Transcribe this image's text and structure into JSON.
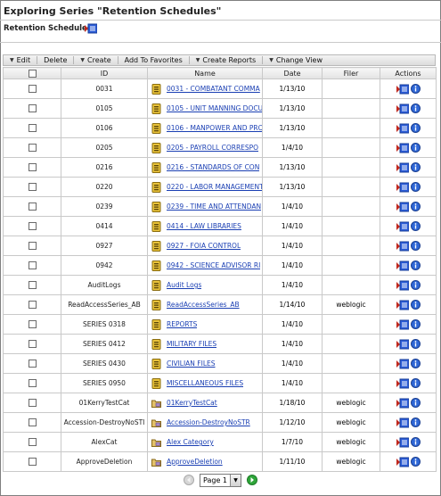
{
  "header": {
    "title": "Exploring Series \"Retention Schedules\"",
    "subtitle": "Retention Schedules"
  },
  "toolbar": {
    "edit": "Edit",
    "delete": "Delete",
    "create": "Create",
    "add_to_favorites": "Add To Favorites",
    "create_reports": "Create Reports",
    "change_view": "Change View"
  },
  "columns": {
    "id": "ID",
    "name": "Name",
    "date": "Date",
    "filer": "Filer",
    "actions": "Actions"
  },
  "rows": [
    {
      "id": "0031",
      "name": "0031 - COMBATANT COMMA",
      "date": "1/13/10",
      "filer": "",
      "icon": "schedule-icon"
    },
    {
      "id": "0105",
      "name": "0105 - UNIT MANNING DOCU",
      "date": "1/13/10",
      "filer": "",
      "icon": "schedule-icon"
    },
    {
      "id": "0106",
      "name": "0106 - MANPOWER AND PRO",
      "date": "1/13/10",
      "filer": "",
      "icon": "schedule-icon"
    },
    {
      "id": "0205",
      "name": "0205 - PAYROLL CORRESPO",
      "date": "1/4/10",
      "filer": "",
      "icon": "schedule-icon"
    },
    {
      "id": "0216",
      "name": "0216 - STANDARDS OF CON",
      "date": "1/13/10",
      "filer": "",
      "icon": "schedule-icon"
    },
    {
      "id": "0220",
      "name": "0220 - LABOR MANAGEMENT",
      "date": "1/13/10",
      "filer": "",
      "icon": "schedule-icon"
    },
    {
      "id": "0239",
      "name": "0239 - TIME AND ATTENDAN",
      "date": "1/4/10",
      "filer": "",
      "icon": "schedule-icon"
    },
    {
      "id": "0414",
      "name": "0414 - LAW LIBRARIES",
      "date": "1/4/10",
      "filer": "",
      "icon": "schedule-icon"
    },
    {
      "id": "0927",
      "name": "0927 - FOIA CONTROL",
      "date": "1/4/10",
      "filer": "",
      "icon": "schedule-icon"
    },
    {
      "id": "0942",
      "name": "0942 - SCIENCE ADVISOR RI",
      "date": "1/4/10",
      "filer": "",
      "icon": "schedule-icon"
    },
    {
      "id": "AuditLogs",
      "name": "Audit Logs",
      "date": "1/4/10",
      "filer": "",
      "icon": "schedule-icon"
    },
    {
      "id": "ReadAccessSeries_AB",
      "name": "ReadAccessSeries_AB",
      "date": "1/14/10",
      "filer": "weblogic",
      "icon": "schedule-icon"
    },
    {
      "id": "SERIES 0318",
      "name": "REPORTS",
      "date": "1/4/10",
      "filer": "",
      "icon": "schedule-icon"
    },
    {
      "id": "SERIES 0412",
      "name": "MILITARY FILES",
      "date": "1/4/10",
      "filer": "",
      "icon": "schedule-icon"
    },
    {
      "id": "SERIES 0430",
      "name": "CIVILIAN FILES",
      "date": "1/4/10",
      "filer": "",
      "icon": "schedule-icon"
    },
    {
      "id": "SERIES 0950",
      "name": "MISCELLANEOUS FILES",
      "date": "1/4/10",
      "filer": "",
      "icon": "schedule-icon"
    },
    {
      "id": "01KerryTestCat",
      "name": "01KerryTestCat",
      "date": "1/18/10",
      "filer": "weblogic",
      "icon": "category-folder-icon"
    },
    {
      "id": "Accession-DestroyNoSTI",
      "name": "Accession-DestroyNoSTR",
      "date": "1/12/10",
      "filer": "weblogic",
      "icon": "category-folder-icon"
    },
    {
      "id": "AlexCat",
      "name": "Alex Category",
      "date": "1/7/10",
      "filer": "weblogic",
      "icon": "category-folder-icon"
    },
    {
      "id": "ApproveDeletion",
      "name": "ApproveDeletion",
      "date": "1/11/10",
      "filer": "weblogic",
      "icon": "category-folder-icon"
    }
  ],
  "pager": {
    "page_label": "Page 1"
  },
  "colors": {
    "link": "#1a3fb3",
    "schedule_icon": "#e8c23a",
    "folder_icon": "#e3c16a",
    "info_icon": "#2f67d6"
  }
}
